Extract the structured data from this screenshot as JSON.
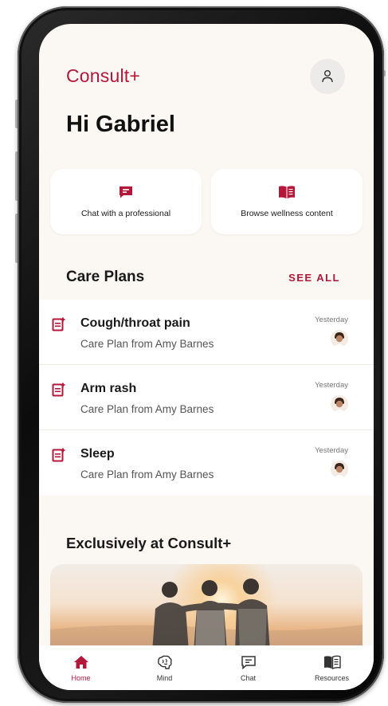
{
  "header": {
    "brand": "Consult+",
    "greeting": "Hi Gabriel"
  },
  "actions": [
    {
      "label": "Chat with a professional",
      "icon": "chat-icon"
    },
    {
      "label": "Browse wellness content",
      "icon": "book-icon"
    }
  ],
  "care_plans": {
    "title": "Care Plans",
    "see_all": "SEE ALL",
    "items": [
      {
        "title": "Cough/throat pain",
        "subtitle": "Care Plan from Amy Barnes",
        "time": "Yesterday"
      },
      {
        "title": "Arm rash",
        "subtitle": "Care Plan from Amy Barnes",
        "time": "Yesterday"
      },
      {
        "title": "Sleep",
        "subtitle": "Care Plan from Amy Barnes",
        "time": "Yesterday"
      }
    ]
  },
  "exclusive": {
    "title": "Exclusively at Consult+"
  },
  "nav": {
    "items": [
      {
        "label": "Home",
        "icon": "home-icon",
        "active": true
      },
      {
        "label": "Mind",
        "icon": "brain-icon",
        "active": false
      },
      {
        "label": "Chat",
        "icon": "chat-icon",
        "active": false
      },
      {
        "label": "Resources",
        "icon": "book-icon",
        "active": false
      }
    ]
  },
  "colors": {
    "accent": "#b3183a",
    "screen_bg": "#fbf7f3"
  }
}
